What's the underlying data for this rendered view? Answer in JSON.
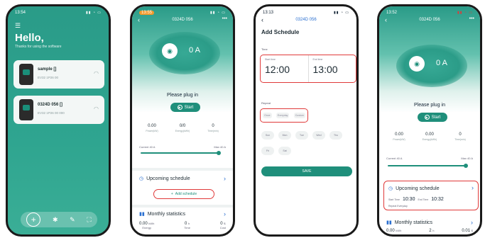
{
  "phone1": {
    "time": "13:54",
    "hello": "Hello,",
    "subtitle": "Thanks for using the software",
    "devices": [
      {
        "name": "sample []",
        "serial": "EV32 1P26 00"
      },
      {
        "name": "0324D 056 []",
        "serial": "EV32 1P26 00 000"
      }
    ]
  },
  "phone2": {
    "time": "13:55",
    "title": "0324D 056",
    "amp": "0 A",
    "status": "Please plug in",
    "start": "Start",
    "stats": [
      {
        "value": "0.00",
        "label": "Power(kW)"
      },
      {
        "value": "0/0",
        "label": "Energy(kWh)"
      },
      {
        "value": "0",
        "label": "Time(min)"
      }
    ],
    "current_label": "Current 40 A",
    "max_label": "Max 40 A",
    "current_fraction": 1.0,
    "upcoming": "Upcoming schedule",
    "add_schedule": "Add schedule",
    "monthly": "Monthly statistics",
    "monthly_stats": [
      {
        "value": "0.00",
        "unit": "kWh",
        "label": "Energy"
      },
      {
        "value": "0",
        "unit": "h",
        "label": "Time"
      },
      {
        "value": "0",
        "unit": "$",
        "label": "Cost"
      }
    ]
  },
  "phone3": {
    "time": "13:13",
    "title": "0324D 056",
    "heading": "Add Schedule",
    "time_label": "Time",
    "start_label": "Start time",
    "end_label": "End time",
    "start_time": "12:00",
    "end_time": "13:00",
    "repeat_label": "Repeat",
    "repeat_chips": [
      "Once",
      "Everyday",
      "Custom"
    ],
    "days": [
      "Sun",
      "Mon",
      "Tue",
      "Wed",
      "Thu",
      "Fri",
      "Sat"
    ],
    "save": "SAVE"
  },
  "phone4": {
    "time": "13:52",
    "title": "0324D 056",
    "amp": "0 A",
    "status": "Please plug in",
    "start": "Start",
    "stats": [
      {
        "value": "0.00",
        "label": "Power(kW)"
      },
      {
        "value": "0.00",
        "label": "Energy(kWh)"
      },
      {
        "value": "0",
        "label": "Time(min)"
      }
    ],
    "current_label": "Current 40 A",
    "max_label": "Max 40 A",
    "current_fraction": 1.0,
    "upcoming": "Upcoming schedule",
    "start_time_label": "Start Time",
    "start_time": "10:30",
    "end_time_label": "End Time",
    "end_time": "10:32",
    "repeat_text": "Repeat  Everyday",
    "monthly": "Monthly statistics",
    "monthly_stats": [
      {
        "value": "0.00",
        "unit": "kWh"
      },
      {
        "value": "2",
        "unit": "h"
      },
      {
        "value": "0.01",
        "unit": "$"
      }
    ]
  },
  "colors": {
    "accent": "#1f8f7b",
    "highlight": "#e03a3a",
    "link": "#2a6fd0"
  }
}
